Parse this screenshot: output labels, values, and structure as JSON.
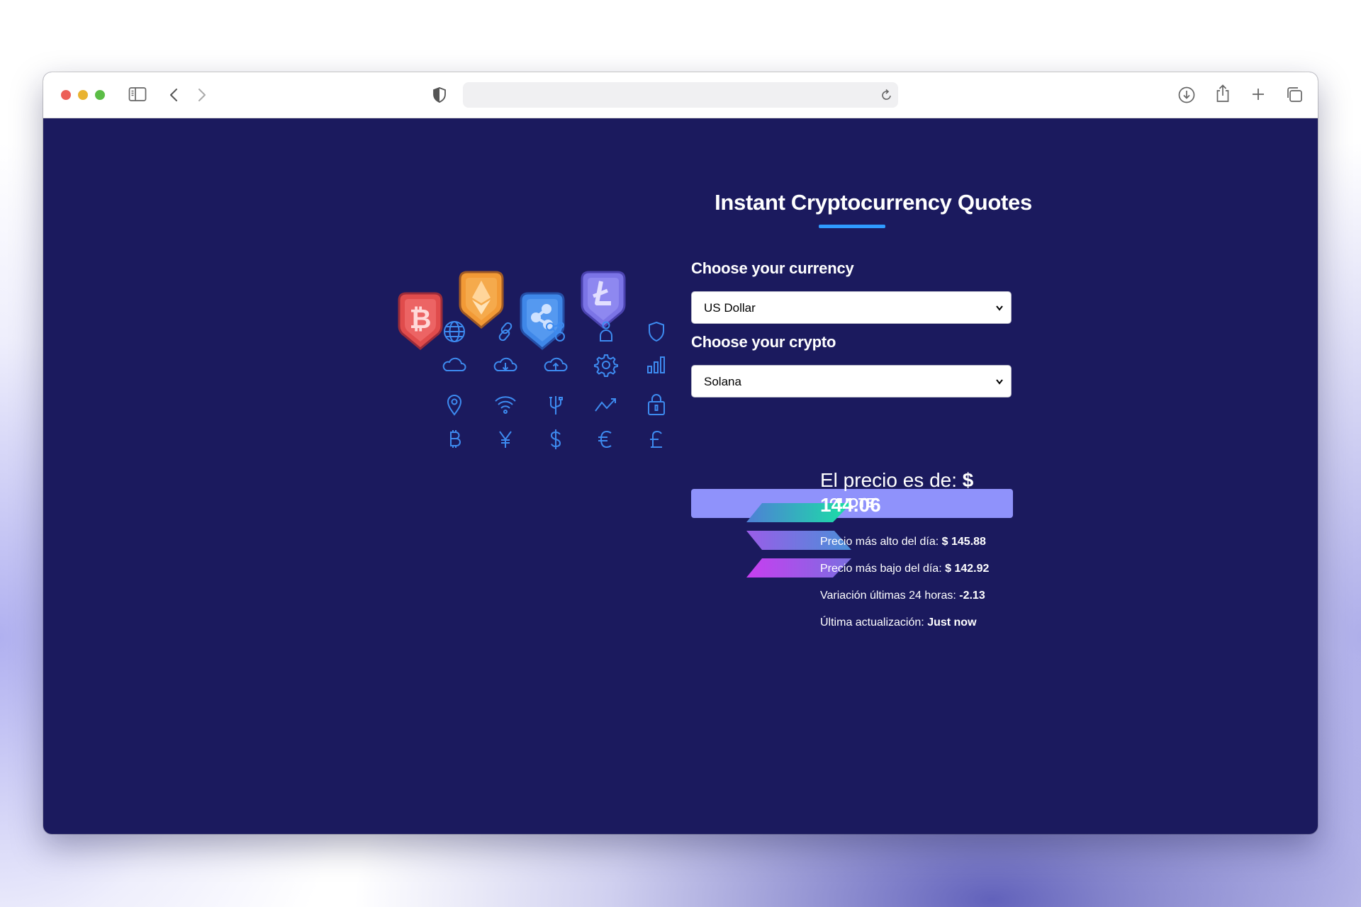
{
  "browser": {
    "url": "",
    "toolbar_icons": [
      "sidebar-icon",
      "back-icon",
      "forward-icon",
      "privacy-shield-icon",
      "reload-icon",
      "download-icon",
      "share-icon",
      "new-tab-icon",
      "tabs-overview-icon"
    ],
    "traffic_lights": {
      "close": "#ec5f57",
      "minimize": "#e9b330",
      "maximize": "#5bbd46"
    }
  },
  "illustration": {
    "badges": [
      {
        "icon": "bitcoin-badge-icon",
        "color": "#e04c4c"
      },
      {
        "icon": "ethereum-badge-icon",
        "color": "#f29a36"
      },
      {
        "icon": "ripple-badge-icon",
        "color": "#3f87e8"
      },
      {
        "icon": "litecoin-badge-icon",
        "color": "#7b74e6"
      }
    ],
    "grid_icons": [
      "globe-icon",
      "link-icon",
      "network-icon",
      "user-icon",
      "shield-icon",
      "cloud-icon",
      "cloud-download-icon",
      "cloud-upload-icon",
      "gear-icon",
      "bar-chart-icon",
      "location-pin-icon",
      "wifi-icon",
      "usb-icon",
      "trend-up-icon",
      "padlock-icon",
      "bitcoin-symbol-icon",
      "yen-icon",
      "dollar-icon",
      "euro-icon",
      "pound-icon"
    ],
    "icon_color": "#3d8bf0"
  },
  "form": {
    "title": "Instant Cryptocurrency Quotes",
    "currency_label": "Choose your currency",
    "currency_value": "US Dollar",
    "crypto_label": "Choose your crypto",
    "crypto_value": "Solana",
    "quote_button": "QUOTE",
    "accent": "#2f9bff",
    "button_color": "#8f92fb"
  },
  "result": {
    "logo": "solana-logo-icon",
    "price_label": "El precio es de:",
    "price_value": "$ 144.06",
    "high_label": "Precio más alto del día:",
    "high_value": "$ 145.88",
    "low_label": "Precio más bajo del día:",
    "low_value": "$ 142.92",
    "change_label": "Variación últimas 24 horas:",
    "change_value": "-2.13",
    "updated_label": "Última actualización:",
    "updated_value": "Just now"
  },
  "colors": {
    "page_background": "#1b1a5e",
    "text": "#ffffff"
  }
}
